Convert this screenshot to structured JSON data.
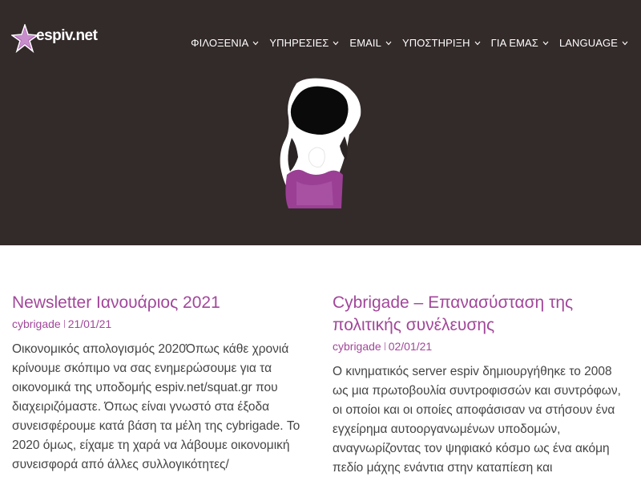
{
  "site": {
    "logo_text": "espiv.net",
    "colors": {
      "header_bg": "#332a2a",
      "accent": "#a2479a",
      "star": "#b06ab5"
    }
  },
  "nav": {
    "items": [
      {
        "label": "ΦΙΛΟΞΕΝΙΑ",
        "icon": "chevron-down-icon"
      },
      {
        "label": "ΥΠΗΡΕΣΙΕΣ",
        "icon": "chevron-down-icon"
      },
      {
        "label": "EMAIL",
        "icon": "chevron-down-icon"
      },
      {
        "label": "ΥΠΟΣΤΗΡΙΞΗ",
        "icon": "chevron-down-icon"
      },
      {
        "label": "ΓΙΑ ΕΜΑΣ",
        "icon": "chevron-down-icon"
      },
      {
        "label": "LANGUAGE",
        "icon": "chevron-down-icon"
      }
    ]
  },
  "hero": {
    "icon": "raised-fist-figure-illustration"
  },
  "posts": [
    {
      "title": "Newsletter Ιανουάριος 2021",
      "author": "cybrigade",
      "date": "21/01/21",
      "excerpt": "Οικονομικός απολογισμός 2020Όπως κάθε χρονιά κρίνουμε σκόπιμο να σας ενημερώσουμε για τα οικονομικά της υποδομής espiv.net/squat.gr που διαχειριζόμαστε. Όπως είναι γνωστό στα έξοδα συνεισφέρουμε κατά βάση τα μέλη της cybrigade. Το 2020 όμως, είχαμε τη χαρά να λάβουμε οικονομική συνεισφορά από άλλες συλλογικότητες/"
    },
    {
      "title": "Cybrigade – Επανασύσταση της πολιτικής συνέλευσης",
      "author": "cybrigade",
      "date": "02/01/21",
      "excerpt": "Ο κινηματικός server espiv δημιουργήθηκε το 2008 ως μια πρωτοβουλία συντροφισσών και συντρόφων, οι οποίοι και οι οποίες αποφάσισαν να στήσουν ένα εγχείρημα αυτοοργανωμένων υποδομών, αναγνωρίζοντας τον ψηφιακό κόσμο ως ένα ακόμη πεδίο μάχης ενάντια στην καταπίεση και"
    }
  ]
}
